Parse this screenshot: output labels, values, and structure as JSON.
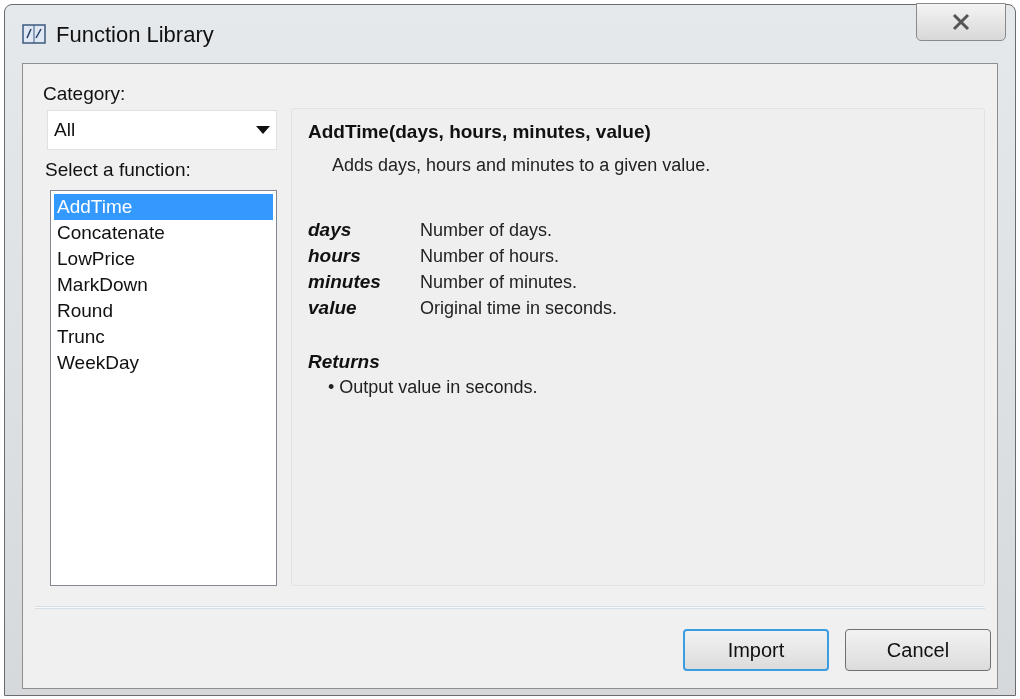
{
  "window": {
    "title": "Function Library"
  },
  "category": {
    "label": "Category:",
    "value": "All"
  },
  "function_list": {
    "label": "Select a function:",
    "items": [
      {
        "name": "AddTime",
        "selected": true
      },
      {
        "name": "Concatenate",
        "selected": false
      },
      {
        "name": "LowPrice",
        "selected": false
      },
      {
        "name": "MarkDown",
        "selected": false
      },
      {
        "name": "Round",
        "selected": false
      },
      {
        "name": "Trunc",
        "selected": false
      },
      {
        "name": "WeekDay",
        "selected": false
      }
    ]
  },
  "detail": {
    "signature": "AddTime(days, hours, minutes, value)",
    "description": "Adds days, hours and minutes to a given value.",
    "parameters": [
      {
        "name": "days",
        "description": "Number of days."
      },
      {
        "name": "hours",
        "description": "Number of hours."
      },
      {
        "name": "minutes",
        "description": "Number of minutes."
      },
      {
        "name": "value",
        "description": "Original time in seconds."
      }
    ],
    "returns_heading": "Returns",
    "returns": [
      "• Output value in seconds."
    ]
  },
  "buttons": [
    {
      "label": "Import",
      "default": true
    },
    {
      "label": "Cancel",
      "default": false
    }
  ]
}
